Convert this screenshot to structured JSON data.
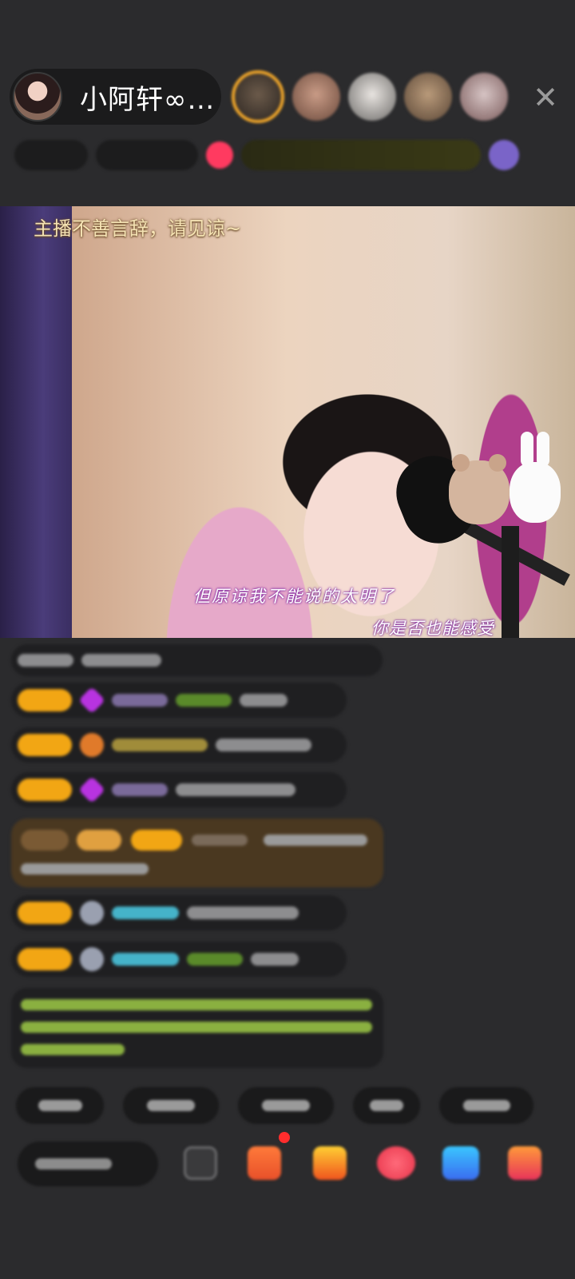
{
  "header": {
    "host_name": "小阿轩∞…",
    "close_icon": "close-icon",
    "viewer_count": 5
  },
  "video": {
    "caption_top": "主播不善言辞，请见谅~",
    "lyric_line_1": "但原谅我不能说的太明了",
    "lyric_line_2": "你是否也能感受"
  },
  "colors": {
    "badge": "#f2a614",
    "gem_purple": "#b833e0",
    "chat_text_green": "#9acd32",
    "name_cyan": "#45b3c9",
    "background": "#2b2b2d"
  },
  "chat": {
    "message_count": 10,
    "note": ""
  },
  "bottom_bar": {
    "icons": [
      "emoji-icon",
      "gift-box-icon",
      "red-packet-icon",
      "heart-gift-icon",
      "game-icon",
      "more-gift-icon"
    ]
  }
}
